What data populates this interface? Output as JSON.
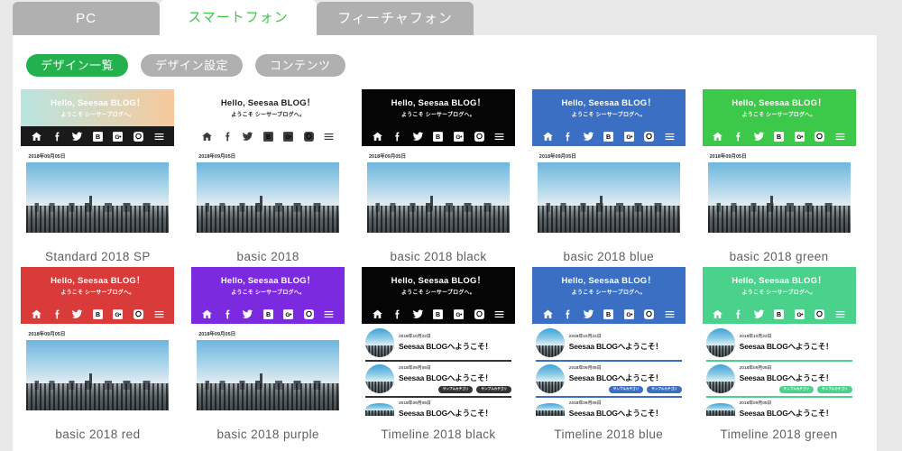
{
  "tabs": [
    {
      "label": "PC",
      "active": false
    },
    {
      "label": "スマートフォン",
      "active": true
    },
    {
      "label": "フィーチャフォン",
      "active": false
    }
  ],
  "toolbar": {
    "buttons": [
      {
        "label": "デザイン一覧",
        "active": true
      },
      {
        "label": "デザイン設定",
        "active": false
      },
      {
        "label": "コンテンツ",
        "active": false
      }
    ]
  },
  "blog_preview": {
    "title": "Hello, Seesaa BLOG！",
    "subtitle": "ようこそ シーサーブログへ。",
    "post_date": "2018年09月05日",
    "nav_icons": [
      "home-icon",
      "facebook-icon",
      "twitter-icon",
      "hatena-icon",
      "google-plus-icon",
      "line-icon",
      "hamburger-menu-icon"
    ]
  },
  "timeline_preview": {
    "entries": [
      {
        "date": "2018年10月22日",
        "title": "Seesaa BLOGへようこそ！",
        "tags": []
      },
      {
        "date": "2018年09月05日",
        "title": "Seesaa BLOGへようこそ！",
        "tags": [
          "サンプルカテゴリ",
          "サンプルカテゴリ"
        ]
      },
      {
        "date": "2018年09月05日",
        "title": "Seesaa BLOGへようこそ！",
        "tags": []
      }
    ]
  },
  "designs": [
    {
      "name": "Standard 2018 SP",
      "kind": "basic",
      "header_style": "gradient",
      "header_gradient_from": "#b9e5df",
      "header_gradient_to": "#f6c99c",
      "header_text_color": "#ffffff",
      "nav_bg": "#1a1a1a",
      "nav_icon_color": "#ffffff"
    },
    {
      "name": "basic 2018",
      "kind": "basic",
      "header_style": "solid",
      "header_bg": "#ffffff",
      "header_text_color": "#1b1b1b",
      "nav_bg": "#ffffff",
      "nav_icon_color": "#3a3a3a"
    },
    {
      "name": "basic 2018 black",
      "kind": "basic",
      "header_style": "solid",
      "header_bg": "#050505",
      "header_text_color": "#ffffff",
      "nav_bg": "#050505",
      "nav_icon_color": "#ffffff"
    },
    {
      "name": "basic 2018 blue",
      "kind": "basic",
      "header_style": "solid",
      "header_bg": "#3a6fc4",
      "header_text_color": "#ffffff",
      "nav_bg": "#3a6fc4",
      "nav_icon_color": "#ffffff"
    },
    {
      "name": "basic 2018 green",
      "kind": "basic",
      "header_style": "solid",
      "header_bg": "#3cc94a",
      "header_text_color": "#ffffff",
      "nav_bg": "#3cc94a",
      "nav_icon_color": "#ffffff"
    },
    {
      "name": "basic 2018 red",
      "kind": "basic",
      "header_style": "solid",
      "header_bg": "#d93a3a",
      "header_text_color": "#ffffff",
      "nav_bg": "#d93a3a",
      "nav_icon_color": "#ffffff"
    },
    {
      "name": "basic 2018 purple",
      "kind": "basic",
      "header_style": "solid",
      "header_bg": "#7c2ae0",
      "header_text_color": "#ffffff",
      "nav_bg": "#7c2ae0",
      "nav_icon_color": "#ffffff"
    },
    {
      "name": "Timeline 2018 black",
      "kind": "timeline",
      "header_style": "solid",
      "header_bg": "#050505",
      "header_text_color": "#ffffff",
      "nav_bg": "#050505",
      "nav_icon_color": "#ffffff",
      "accent": "#333333"
    },
    {
      "name": "Timeline 2018 blue",
      "kind": "timeline",
      "header_style": "solid",
      "header_bg": "#3a6fc4",
      "header_text_color": "#ffffff",
      "nav_bg": "#3a6fc4",
      "nav_icon_color": "#ffffff",
      "accent": "#3a6fc4"
    },
    {
      "name": "Timeline 2018 green",
      "kind": "timeline",
      "header_style": "solid",
      "header_bg": "#4ad18c",
      "header_text_color": "#ffffff",
      "nav_bg": "#4ad18c",
      "nav_icon_color": "#ffffff",
      "accent": "#4ad18c"
    }
  ]
}
